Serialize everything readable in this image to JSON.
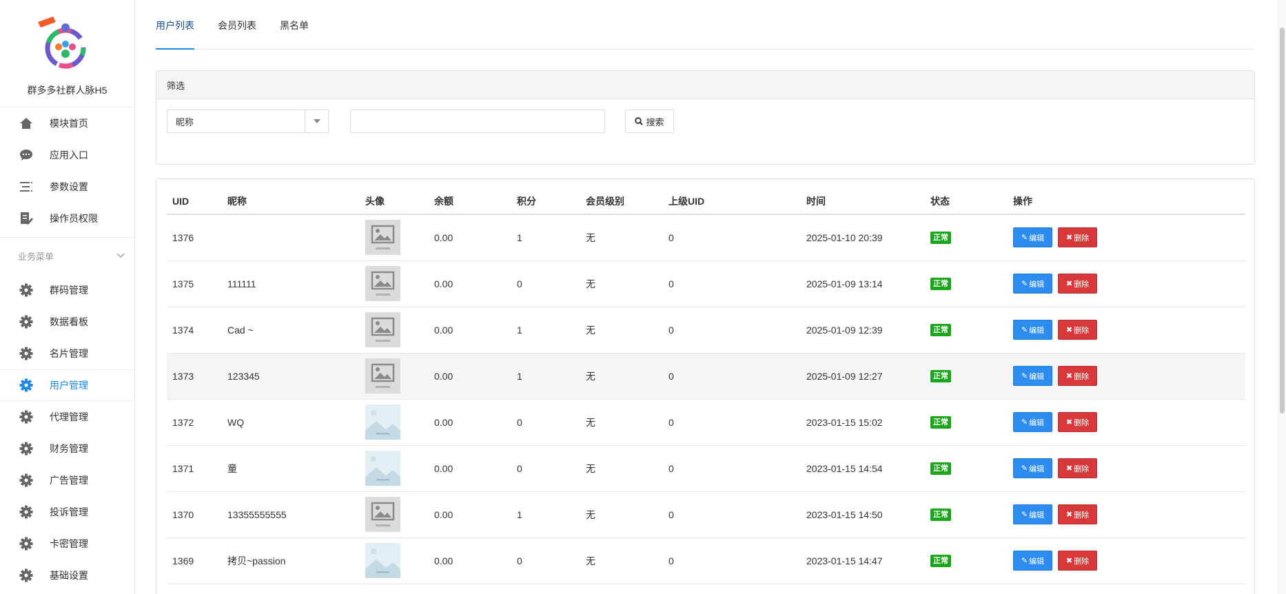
{
  "app": {
    "name": "群多多社群人脉H5"
  },
  "sidebar": {
    "top_items": [
      {
        "label": "模块首页",
        "icon": "home-icon"
      },
      {
        "label": "应用入口",
        "icon": "chat-icon"
      },
      {
        "label": "参数设置",
        "icon": "list-icon"
      },
      {
        "label": "操作员权限",
        "icon": "edit-doc-icon"
      }
    ],
    "group_label": "业务菜单",
    "group_items": [
      {
        "label": "群码管理",
        "icon": "gear-icon",
        "active": false
      },
      {
        "label": "数据看板",
        "icon": "gear-icon",
        "active": false
      },
      {
        "label": "名片管理",
        "icon": "gear-icon",
        "active": false
      },
      {
        "label": "用户管理",
        "icon": "gear-icon",
        "active": true
      },
      {
        "label": "代理管理",
        "icon": "gear-icon",
        "active": false
      },
      {
        "label": "财务管理",
        "icon": "gear-icon",
        "active": false
      },
      {
        "label": "广告管理",
        "icon": "gear-icon",
        "active": false
      },
      {
        "label": "投诉管理",
        "icon": "gear-icon",
        "active": false
      },
      {
        "label": "卡密管理",
        "icon": "gear-icon",
        "active": false
      },
      {
        "label": "基础设置",
        "icon": "gear-icon",
        "active": false
      }
    ]
  },
  "tabs": [
    {
      "label": "用户列表",
      "active": true
    },
    {
      "label": "会员列表",
      "active": false
    },
    {
      "label": "黑名单",
      "active": false
    }
  ],
  "filter": {
    "title": "筛选",
    "select_value": "昵称",
    "search_value": "",
    "search_label": "搜索"
  },
  "table": {
    "columns": [
      "UID",
      "昵称",
      "头像",
      "余额",
      "积分",
      "会员级别",
      "上级UID",
      "时间",
      "状态",
      "操作"
    ],
    "edit_label": "编辑",
    "delete_label": "删除",
    "rows": [
      {
        "uid": "1376",
        "nickname": "",
        "avatar": "placeholder",
        "balance": "0.00",
        "points": "1",
        "level": "无",
        "parent": "0",
        "time": "2025-01-10 20:39",
        "status": "正常"
      },
      {
        "uid": "1375",
        "nickname": "111111",
        "avatar": "placeholder",
        "balance": "0.00",
        "points": "0",
        "level": "无",
        "parent": "0",
        "time": "2025-01-09 13:14",
        "status": "正常"
      },
      {
        "uid": "1374",
        "nickname": "Cad ~",
        "avatar": "placeholder",
        "balance": "0.00",
        "points": "1",
        "level": "无",
        "parent": "0",
        "time": "2025-01-09 12:39",
        "status": "正常"
      },
      {
        "uid": "1373",
        "nickname": "123345",
        "avatar": "placeholder",
        "balance": "0.00",
        "points": "1",
        "level": "无",
        "parent": "0",
        "time": "2025-01-09 12:27",
        "status": "正常"
      },
      {
        "uid": "1372",
        "nickname": "WQ",
        "avatar": "landscape",
        "balance": "0.00",
        "points": "0",
        "level": "无",
        "parent": "0",
        "time": "2023-01-15 15:02",
        "status": "正常"
      },
      {
        "uid": "1371",
        "nickname": "童",
        "avatar": "landscape",
        "balance": "0.00",
        "points": "0",
        "level": "无",
        "parent": "0",
        "time": "2023-01-15 14:54",
        "status": "正常"
      },
      {
        "uid": "1370",
        "nickname": "13355555555",
        "avatar": "placeholder",
        "balance": "0.00",
        "points": "1",
        "level": "无",
        "parent": "0",
        "time": "2023-01-15 14:50",
        "status": "正常"
      },
      {
        "uid": "1369",
        "nickname": "拷贝~passion",
        "avatar": "landscape",
        "balance": "0.00",
        "points": "0",
        "level": "无",
        "parent": "0",
        "time": "2023-01-15 14:47",
        "status": "正常"
      }
    ]
  },
  "colors": {
    "accent": "#1e88e5",
    "edit": "#2d8cf0",
    "delete": "#d9383a",
    "status": "#1aa51a"
  }
}
